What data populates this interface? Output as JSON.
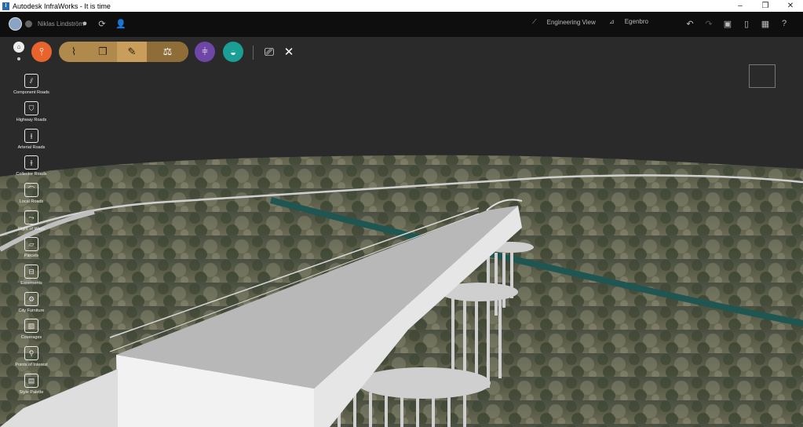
{
  "window": {
    "title": "Autodesk InfraWorks - It is time",
    "minimize": "–",
    "maximize": "❐",
    "close": "✕"
  },
  "appbar": {
    "username": "Niklas Lindström",
    "view_mode": "Engineering View",
    "model_name": "Egenbro"
  },
  "palette": {
    "items": [
      {
        "label": "Component Roads",
        "icon": "component-roads-icon"
      },
      {
        "label": "Highway Roads",
        "icon": "highway-roads-icon"
      },
      {
        "label": "Arterial Roads",
        "icon": "arterial-roads-icon"
      },
      {
        "label": "Collector Roads",
        "icon": "collector-roads-icon"
      },
      {
        "label": "Local Roads",
        "icon": "local-roads-icon"
      },
      {
        "label": "Right of Ways",
        "icon": "right-of-ways-icon"
      },
      {
        "label": "Parcels",
        "icon": "parcels-icon"
      },
      {
        "label": "Easements",
        "icon": "easements-icon"
      },
      {
        "label": "City Furniture",
        "icon": "city-furniture-icon"
      },
      {
        "label": "Coverages",
        "icon": "coverages-icon"
      },
      {
        "label": "Points of Interest",
        "icon": "points-of-interest-icon"
      },
      {
        "label": "Style Palette",
        "icon": "style-palette-icon"
      }
    ]
  },
  "colors": {
    "accent_orange": "#e8642c",
    "ribbon_gold": "#b08a4c",
    "bridge_purple": "#6e46a8",
    "drainage_teal": "#1a9e96",
    "titlebar_bg": "#ffffff",
    "appbar_bg": "#0e0e0e"
  }
}
